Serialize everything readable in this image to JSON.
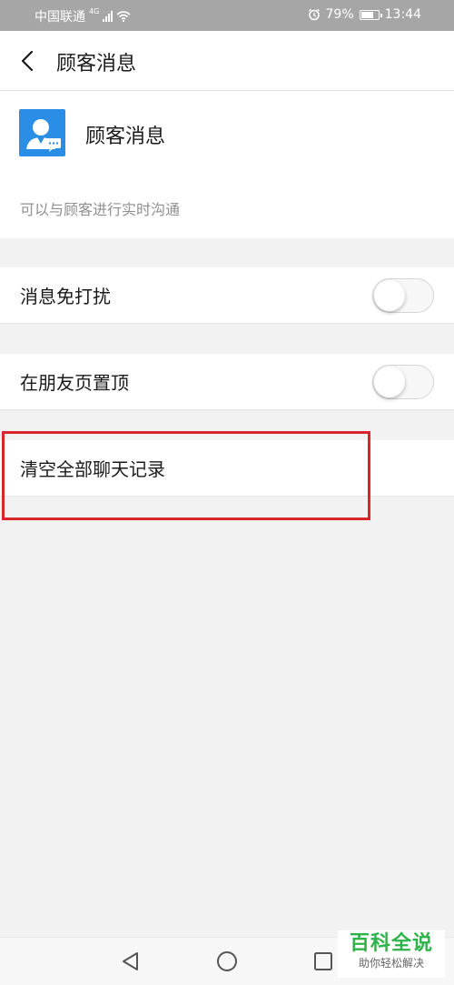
{
  "status_bar": {
    "carrier": "中国联通",
    "network": "4G",
    "battery": "79%",
    "battery_level": 0.79,
    "time": "13:44"
  },
  "header": {
    "back_icon": "chevron-left-icon",
    "title": "顾客消息"
  },
  "profile": {
    "avatar_icon": "customer-service-icon",
    "avatar_color": "#2a8ee6",
    "name": "顾客消息",
    "description": "可以与顾客进行实时沟通"
  },
  "settings": [
    {
      "label": "消息免打扰",
      "toggle": false
    },
    {
      "label": "在朋友页置顶",
      "toggle": false
    },
    {
      "label": "清空全部聊天记录"
    }
  ],
  "highlight_color": "#d9252e",
  "nav_bar": {
    "back": "triangle-back-icon",
    "home": "circle-home-icon",
    "recents": "square-recents-icon"
  },
  "watermark": {
    "title": "百科全说",
    "subtitle": "助你轻松解决"
  }
}
